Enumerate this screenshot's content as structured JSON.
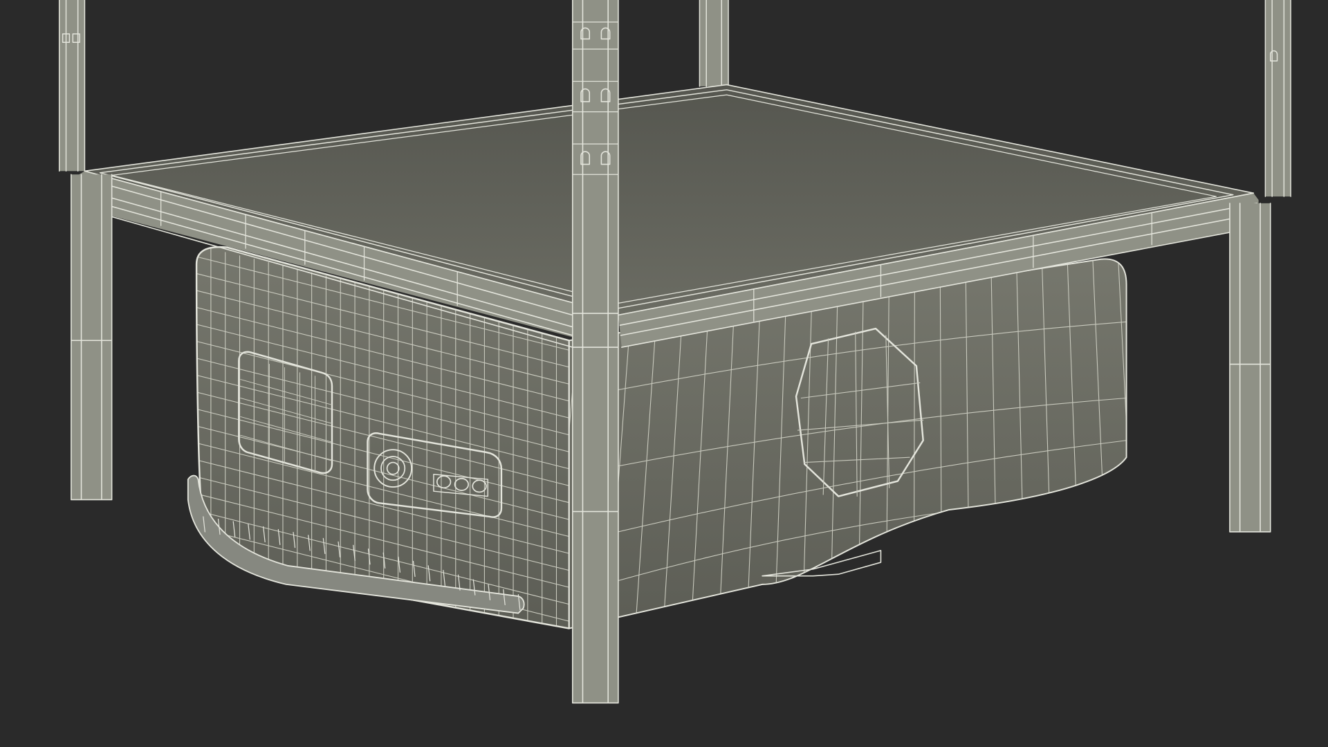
{
  "scene": {
    "colors": {
      "background": "#2a2a2a",
      "model_fill": "#76776d",
      "model_fill_dark": "#5c5d55",
      "shelf_fill": "#55564f",
      "shelf_fill_light": "#6b6c63",
      "frame_fill": "#8f9186",
      "wire": "#e4e5dc",
      "wire_soft": "#c9cabe",
      "edge_shadow": "#3d3e39"
    }
  }
}
